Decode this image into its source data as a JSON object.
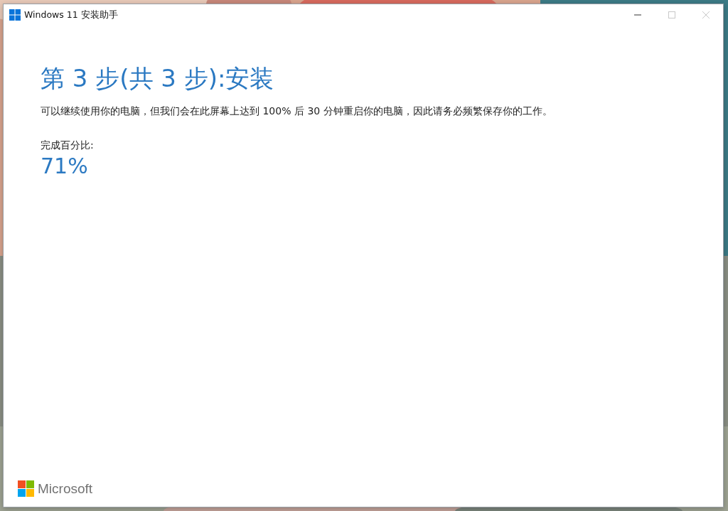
{
  "window": {
    "title": "Windows 11 安装助手",
    "controls": [
      {
        "kind": "minimize",
        "disabled": false
      },
      {
        "kind": "maximize",
        "disabled": true
      },
      {
        "kind": "close",
        "disabled": true
      }
    ]
  },
  "heading": "第 3 步(共 3 步):安装",
  "description": "可以继续使用你的电脑，但我们会在此屏幕上达到 100% 后 30 分钟重启你的电脑，因此请务必频繁保存你的工作。",
  "progress": {
    "label": "完成百分比:",
    "value": "71%"
  },
  "footer": {
    "brand": "Microsoft"
  }
}
